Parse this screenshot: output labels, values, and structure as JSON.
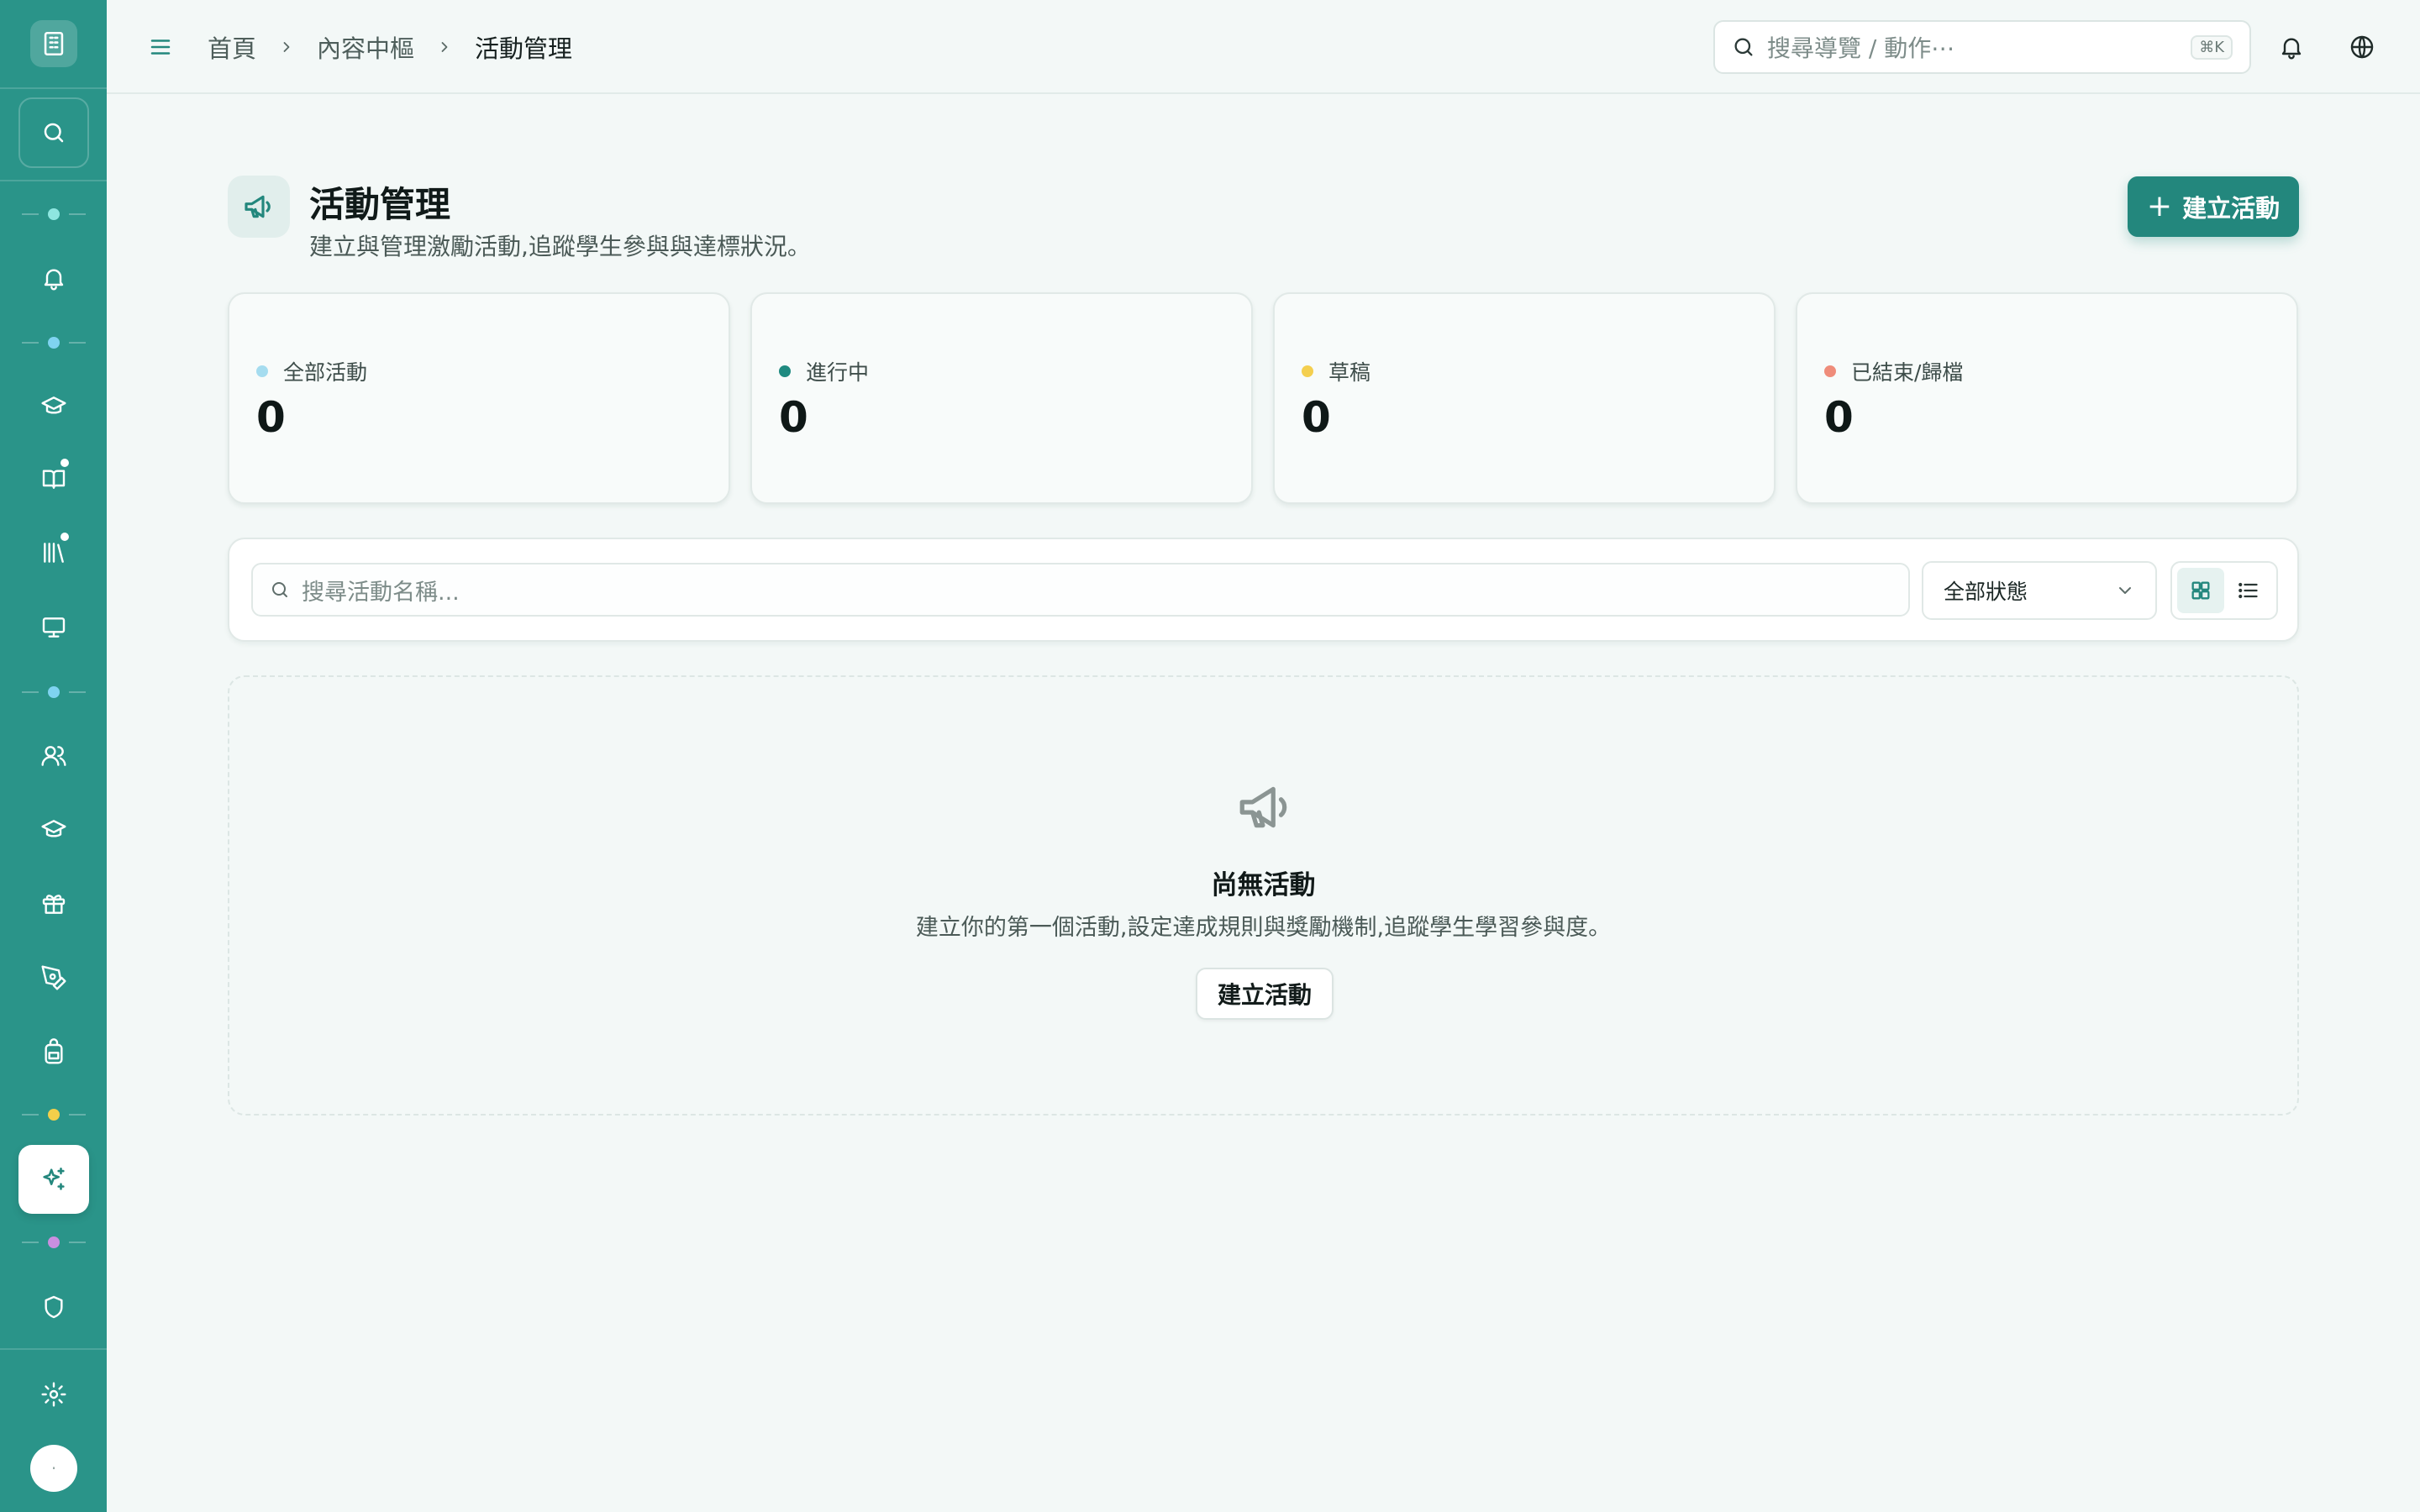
{
  "sidebar": {
    "colors": {
      "background": "#2a9489",
      "active_background": "#ffffff"
    },
    "logo_icon": "building-icon",
    "search_icon": "search-icon",
    "groups": [
      {
        "dot_color": "#8ee6e0"
      },
      {
        "dot_color": "#7fd3f0"
      },
      {
        "dot_color": "#7fd3f0"
      },
      {
        "dot_color": "#f3cf4a"
      },
      {
        "dot_color": "#c98fe0"
      }
    ],
    "items": [
      {
        "icon": "bell-icon",
        "badge": false,
        "active": false
      },
      {
        "icon": "graduation-cap-icon",
        "badge": false,
        "active": false
      },
      {
        "icon": "book-open-icon",
        "badge": true,
        "active": false
      },
      {
        "icon": "library-icon",
        "badge": true,
        "active": false
      },
      {
        "icon": "monitor-icon",
        "badge": false,
        "active": false
      },
      {
        "icon": "users-icon",
        "badge": false,
        "active": false
      },
      {
        "icon": "graduation-cap-icon",
        "badge": false,
        "active": false
      },
      {
        "icon": "gift-icon",
        "badge": false,
        "active": false
      },
      {
        "icon": "pen-tool-icon",
        "badge": false,
        "active": false
      },
      {
        "icon": "backpack-icon",
        "badge": false,
        "active": false
      },
      {
        "icon": "sparkles-icon",
        "badge": false,
        "active": true
      },
      {
        "icon": "shield-icon",
        "badge": false,
        "active": false
      },
      {
        "icon": "settings-icon",
        "badge": false,
        "active": false
      }
    ]
  },
  "topbar": {
    "breadcrumb": [
      "首頁",
      "內容中樞",
      "活動管理"
    ],
    "search_placeholder": "搜尋導覽 / 動作⋯",
    "search_shortcut": "⌘K",
    "icons": [
      "menu-icon",
      "bell-icon",
      "globe-icon"
    ]
  },
  "header": {
    "icon": "megaphone-icon",
    "title": "活動管理",
    "subtitle": "建立與管理激勵活動,追蹤學生參與與達標狀況。",
    "create_button": "建立活動",
    "accent_color": "#23877d"
  },
  "stats": [
    {
      "label": "全部活動",
      "value": "0",
      "dot_color": "#a5dcef"
    },
    {
      "label": "進行中",
      "value": "0",
      "dot_color": "#1f8a80"
    },
    {
      "label": "草稿",
      "value": "0",
      "dot_color": "#f4cf4f"
    },
    {
      "label": "已結束/歸檔",
      "value": "0",
      "dot_color": "#ef8c7a"
    }
  ],
  "filters": {
    "search_placeholder": "搜尋活動名稱...",
    "status_selected": "全部狀態",
    "view_modes": [
      {
        "icon": "grid-icon",
        "selected": true
      },
      {
        "icon": "list-icon",
        "selected": false
      }
    ]
  },
  "empty_state": {
    "icon": "megaphone-icon",
    "title": "尚無活動",
    "description": "建立你的第一個活動,設定達成規則與獎勵機制,追蹤學生學習參與度。",
    "button": "建立活動"
  }
}
